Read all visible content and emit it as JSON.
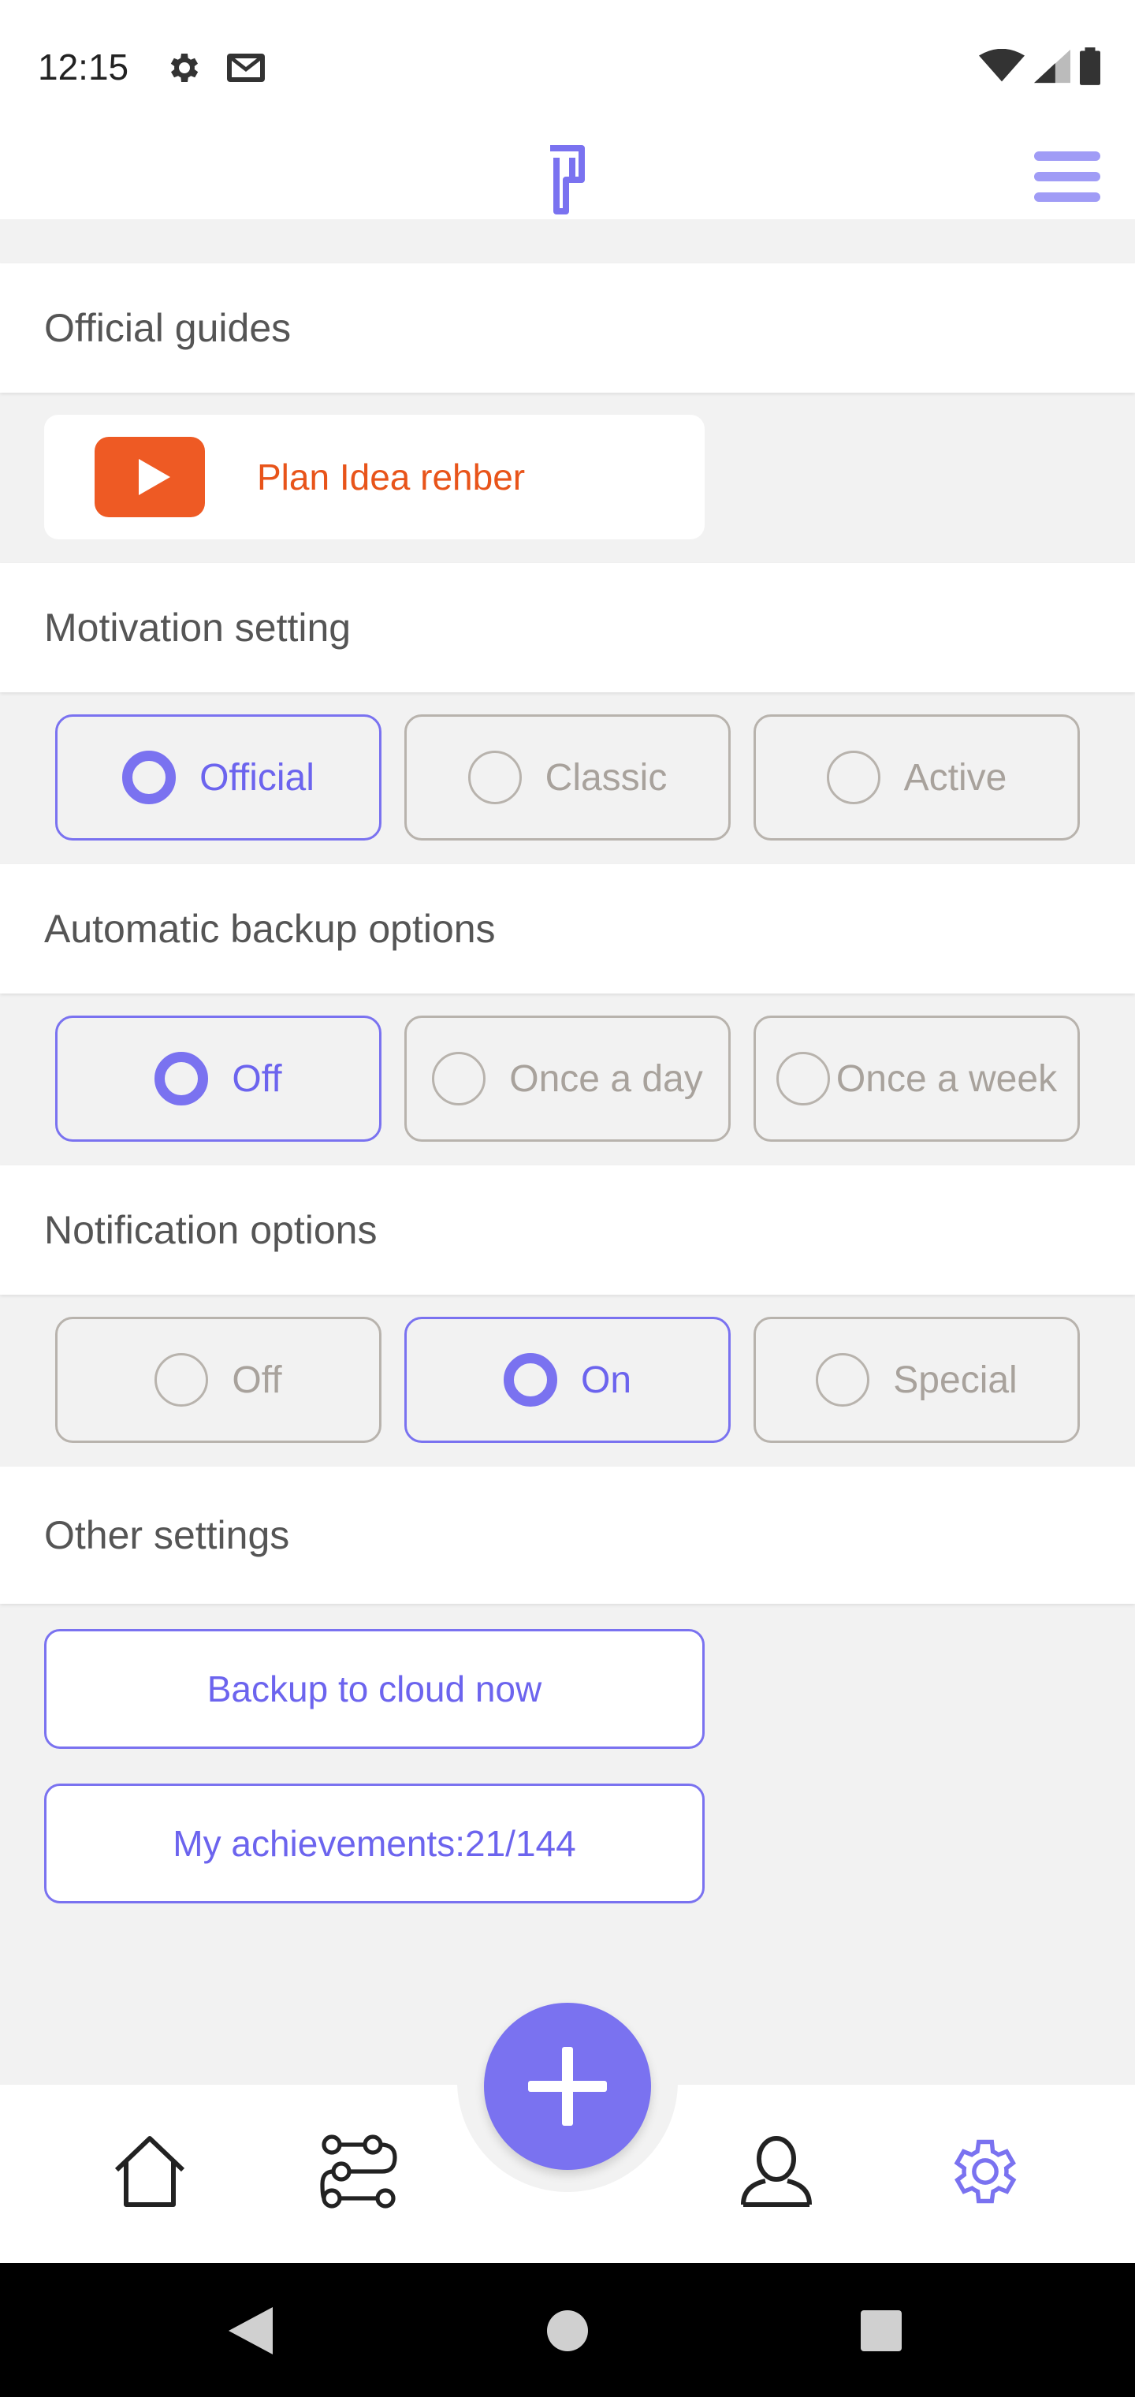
{
  "status_bar": {
    "time": "12:15",
    "icons_left": [
      "gear-icon",
      "gmail-icon"
    ],
    "icons_right": [
      "wifi-icon",
      "signal-icon",
      "battery-icon"
    ]
  },
  "header": {
    "logo": "plan-idea-logo",
    "menu_icon": "hamburger-menu-icon"
  },
  "sections": {
    "guides": {
      "title": "Official guides",
      "item_label": "Plan Idea rehber",
      "item_icon": "youtube-play-icon"
    },
    "motivation": {
      "title": "Motivation setting",
      "options": [
        "Official",
        "Classic",
        "Active"
      ],
      "selected": "Official"
    },
    "backup": {
      "title": "Automatic backup options",
      "options": [
        "Off",
        "Once a day",
        "Once a week"
      ],
      "selected": "Off"
    },
    "notification": {
      "title": "Notification options",
      "options": [
        "Off",
        "On",
        "Special"
      ],
      "selected": "On"
    },
    "other": {
      "title": "Other settings",
      "backup_button": "Backup to cloud now",
      "achievements_button": "My achievements:21/144"
    }
  },
  "bottom_nav": {
    "items": [
      "home-icon",
      "routes-icon",
      "add-icon",
      "profile-icon",
      "settings-icon"
    ],
    "active": "settings-icon"
  },
  "colors": {
    "accent": "#7a72f0",
    "guide_orange": "#e8541a",
    "unselected_border": "#b8b3ad",
    "background": "#f2f2f2"
  }
}
